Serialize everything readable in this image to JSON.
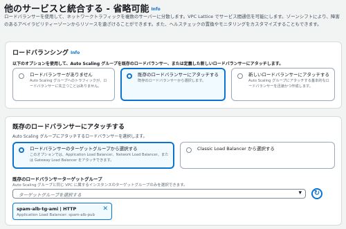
{
  "page": {
    "title": "他のサービスと統合する - 省略可能",
    "info": "Info",
    "description": "ロードバランサーを使用して、ネットワークトラフィックを複数のサーバーに分散します。VPC Lattice でサービス間通信を可能にします。ゾーンシフトにより、障害のあるアベイラビリティーゾーンからリソースを遠ざけることができます。また、ヘルスチェックの置換やモニタリングをカスタマイズすることもできます。"
  },
  "load_balancing": {
    "title": "ロードバランシング",
    "info": "Info",
    "description": "以下のオプションを使用して、Auto Scaling グループを既存のロードバランサー、または定義した新しいロードバランサーにアタッチします。",
    "options": [
      {
        "label": "ロードバランサーがありません",
        "desc": "Auto Scaling グループへのトラフィックが、ロードバランサーに先立つことはありません。",
        "selected": false
      },
      {
        "label": "既存のロードバランサーにアタッチする",
        "desc": "既存のロードバランサーから選択します。",
        "selected": true
      },
      {
        "label": "新しいロードバランサーにアタッチする",
        "desc": "Auto Scaling グループにアタッチする基本的なロードバランサーを迅速かつ作成します。",
        "selected": false
      }
    ]
  },
  "attach_existing": {
    "title": "既存のロードバランサーにアタッチする",
    "description": "Auto Scaling グループにアタッチするロードバランサーを選択します。",
    "options": [
      {
        "label": "ロードバランサーのターゲットグループから選択する",
        "desc": "このオプションでは、Application Load Balancer、Network Load Balancer、または Gateway Load Balancer をアタッチできます。",
        "selected": true
      },
      {
        "label": "Classic Load Balancer から選択する",
        "desc": "",
        "selected": false
      }
    ],
    "target_group": {
      "label": "既存のロードバランサーターゲットグループ",
      "desc": "Auto Scaling グループと同じ VPC に属するインスタンスのターゲットグループのみを選択できます。",
      "placeholder": "ターゲットグループを選択する",
      "caret_icon": "caret-down-icon",
      "refresh_icon": "refresh-icon",
      "selected_token": {
        "title": "spam-alb-tg-ami | HTTP",
        "subtitle": "Application Load Balancer: spam-alb-pub",
        "close_icon": "close-icon"
      }
    }
  },
  "colors": {
    "accent": "#0972d3",
    "selected_bg": "#f1faff",
    "border": "#9ba7b6",
    "background": "#f2f3f3"
  }
}
